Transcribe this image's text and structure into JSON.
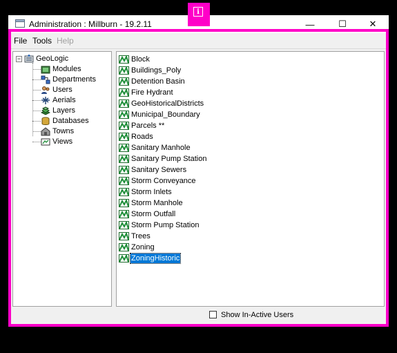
{
  "window": {
    "title": "Administration : Millburn - 19.2.11",
    "minimize_glyph": "—",
    "maximize_glyph": "☐",
    "close_glyph": "✕"
  },
  "menubar": {
    "items": [
      {
        "label": "File",
        "enabled": true
      },
      {
        "label": "Tools",
        "enabled": true
      },
      {
        "label": "Help",
        "enabled": false
      }
    ]
  },
  "tree": {
    "root": {
      "label": "GeoLogic",
      "expander": "−",
      "icon": "server-icon"
    },
    "children": [
      {
        "label": "Modules",
        "icon": "modules-icon"
      },
      {
        "label": "Departments",
        "icon": "departments-icon"
      },
      {
        "label": "Users",
        "icon": "users-icon"
      },
      {
        "label": "Aerials",
        "icon": "aerials-icon"
      },
      {
        "label": "Layers",
        "icon": "layers-icon"
      },
      {
        "label": "Databases",
        "icon": "databases-icon"
      },
      {
        "label": "Towns",
        "icon": "towns-icon"
      },
      {
        "label": "Views",
        "icon": "views-icon"
      }
    ]
  },
  "layers_list": {
    "items": [
      {
        "label": "Block"
      },
      {
        "label": "Buildings_Poly"
      },
      {
        "label": "Detention Basin"
      },
      {
        "label": "Fire Hydrant"
      },
      {
        "label": "GeoHistoricalDistricts"
      },
      {
        "label": "Municipal_Boundary"
      },
      {
        "label": "Parcels **"
      },
      {
        "label": "Roads"
      },
      {
        "label": "Sanitary Manhole"
      },
      {
        "label": "Sanitary Pump Station"
      },
      {
        "label": "Sanitary Sewers"
      },
      {
        "label": "Storm Conveyance"
      },
      {
        "label": "Storm Inlets"
      },
      {
        "label": "Storm Manhole"
      },
      {
        "label": "Storm Outfall"
      },
      {
        "label": "Storm Pump Station"
      },
      {
        "label": "Trees"
      },
      {
        "label": "Zoning"
      },
      {
        "label": "ZoningHistoric",
        "selected": true
      }
    ],
    "item_icon": "map-layer-icon"
  },
  "footer": {
    "show_inactive_label": "Show In-Active Users",
    "show_inactive_checked": false
  },
  "overlay": {
    "info_glyph": "i",
    "highlight_color": "#ff00c8"
  },
  "colors": {
    "selection": "#0078d7",
    "layer_icon": "#1f8f3a"
  }
}
